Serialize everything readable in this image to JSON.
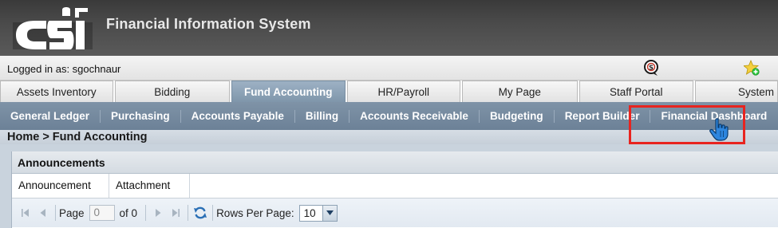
{
  "app": {
    "logo_text": "CSI",
    "title": "Financial Information System"
  },
  "userbar": {
    "logged_in": "Logged in as: sgochnaur"
  },
  "main_tabs": [
    {
      "label": "Assets Inventory",
      "active": false
    },
    {
      "label": "Bidding",
      "active": false
    },
    {
      "label": "Fund Accounting",
      "active": true
    },
    {
      "label": "HR/Payroll",
      "active": false
    },
    {
      "label": "My Page",
      "active": false
    },
    {
      "label": "Staff Portal",
      "active": false
    },
    {
      "label": "System",
      "active": false
    }
  ],
  "sub_nav": [
    {
      "label": "General Ledger"
    },
    {
      "label": "Purchasing"
    },
    {
      "label": "Accounts Payable"
    },
    {
      "label": "Billing"
    },
    {
      "label": "Accounts Receivable"
    },
    {
      "label": "Budgeting"
    },
    {
      "label": "Report Builder"
    },
    {
      "label": "Financial Dashboard"
    }
  ],
  "breadcrumb": "Home > Fund Accounting",
  "announcements": {
    "title": "Announcements",
    "columns": [
      "Announcement",
      "Attachment"
    ]
  },
  "pager": {
    "page_label": "Page",
    "page_value": "0",
    "of_label": "of 0",
    "rows_label": "Rows Per Page:",
    "rows_value": "10"
  },
  "colors": {
    "highlight": "#e8241f",
    "active_tab": "#8aa0b5",
    "subnav": "#7589a0"
  }
}
